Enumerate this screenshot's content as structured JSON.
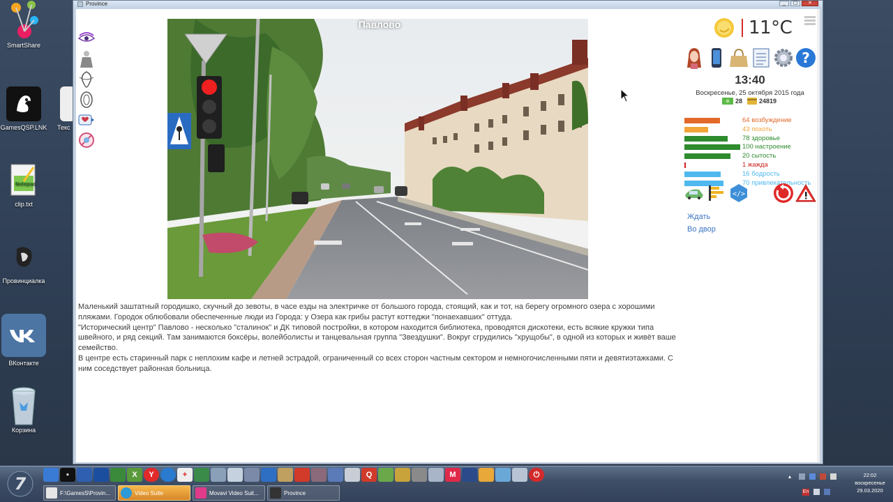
{
  "desktop": {
    "icons": [
      {
        "label": "SmartShare",
        "icon": "smartshare-icon"
      },
      {
        "label": "GamesQSP.LNK",
        "icon": "games-qsp-icon"
      },
      {
        "label": "Текс",
        "icon": "text-file-icon"
      },
      {
        "label": "clip.txt",
        "icon": "notepad-file-icon"
      },
      {
        "label": "Провинциалка",
        "icon": "provincialka-icon"
      },
      {
        "label": "ВКонтакте",
        "icon": "vk-icon"
      },
      {
        "label": "Корзина",
        "icon": "recycle-bin-icon"
      }
    ]
  },
  "window": {
    "title": "Province",
    "scene_title": "Павлово",
    "description": [
      "Маленький заштатный городишко, скучный до зевоты, в часе езды на электричке от большого города, стоящий, как и тот, на берегу огромного озера с хорошими пляжами. Городок облюбовали обеспеченные люди из Города: у Озера как грибы растут коттеджи \"понаехавших\" оттуда.",
      "\"Исторический центр\" Павлово - несколько \"сталинок\" и ДК типовой постройки, в котором находится библиотека, проводятся дискотеки, есть всякие кружки типа швейного, и ряд секций. Там занимаются боксёры, волейболисты и танцевальная группа \"Звездушки\". Вокруг сгрудились \"хрущобы\", в одной из которых и живёт ваше семейство.",
      "В центре есть старинный парк с неплохим кафе и летней эстрадой, ограниченный со всех сторон частным сектором и немногочисленными пяти и девятиэтажками. С ним соседствует районная больница."
    ]
  },
  "right_panel": {
    "temperature": "11°C",
    "time": "13:40",
    "date": "Воскресенье, 25 октября 2015 года",
    "money_cash": "28",
    "money_card": "24819",
    "stats": [
      {
        "label": "64 возбуждение",
        "value": 64,
        "color": "#e2692a",
        "text_color": "#e2692a"
      },
      {
        "label": "43 похоть",
        "value": 43,
        "color": "#f3a53a",
        "text_color": "#f3a53a"
      },
      {
        "label": "78 здоровье",
        "value": 78,
        "color": "#2e8b2e",
        "text_color": "#2e8b2e"
      },
      {
        "label": "100 настроение",
        "value": 100,
        "color": "#2e8b2e",
        "text_color": "#2e8b2e"
      },
      {
        "label": "20 сытость",
        "value": 82,
        "color": "#2e8b2e",
        "text_color": "#2e8b2e"
      },
      {
        "label": "1 жажда",
        "value": 1,
        "color": "#cc1f1f",
        "text_color": "#cc1f1f"
      },
      {
        "label": "16 бодрость",
        "value": 65,
        "color": "#4fb8ef",
        "text_color": "#4fb8ef"
      },
      {
        "label": "70 привлекательность",
        "value": 70,
        "color": "#4fb8ef",
        "text_color": "#4fb8ef"
      }
    ],
    "actions": [
      "Ждать",
      "Во двор"
    ]
  },
  "taskbar": {
    "tasks": [
      {
        "label": "F:\\GamesS\\Provin...",
        "active": false
      },
      {
        "label": "Video Suite",
        "active": true
      },
      {
        "label": "Movavi Video Suit...",
        "active": false
      },
      {
        "label": "Province",
        "active": false
      }
    ],
    "tray_time": "22:02",
    "tray_day": "воскресенье",
    "tray_date": "29.03.2020"
  }
}
